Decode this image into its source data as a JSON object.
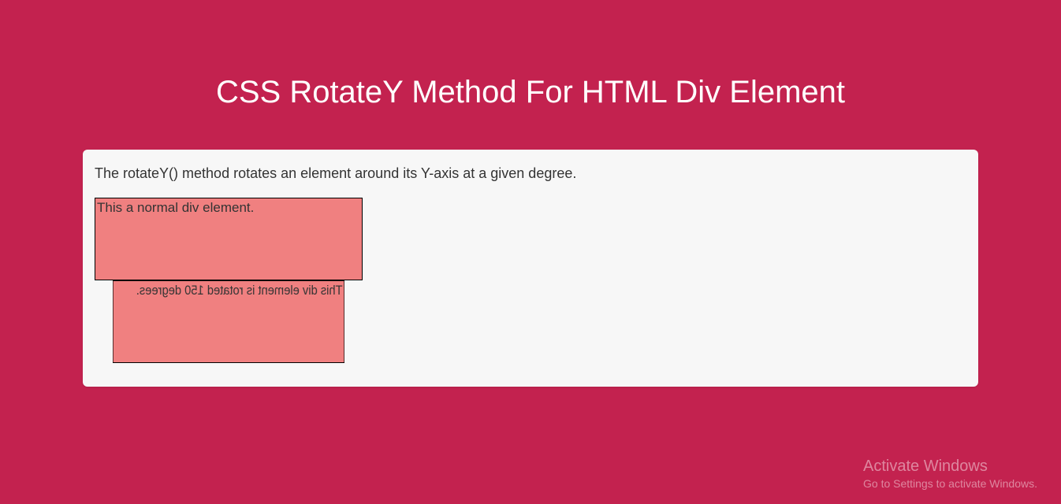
{
  "header": {
    "title": "CSS RotateY Method For HTML Div Element"
  },
  "card": {
    "description": "The rotateY() method rotates an element around its Y-axis at a given degree.",
    "normal_box_text": "This a normal div element.",
    "rotated_box_text": "This div element is rotated 150 degrees.",
    "rotation_degrees": 150,
    "colors": {
      "page_background": "#c3224f",
      "card_background": "#f7f7f7",
      "box_background": "#f08080",
      "box_border": "#000000"
    }
  },
  "watermark": {
    "title": "Activate Windows",
    "subtitle": "Go to Settings to activate Windows."
  }
}
